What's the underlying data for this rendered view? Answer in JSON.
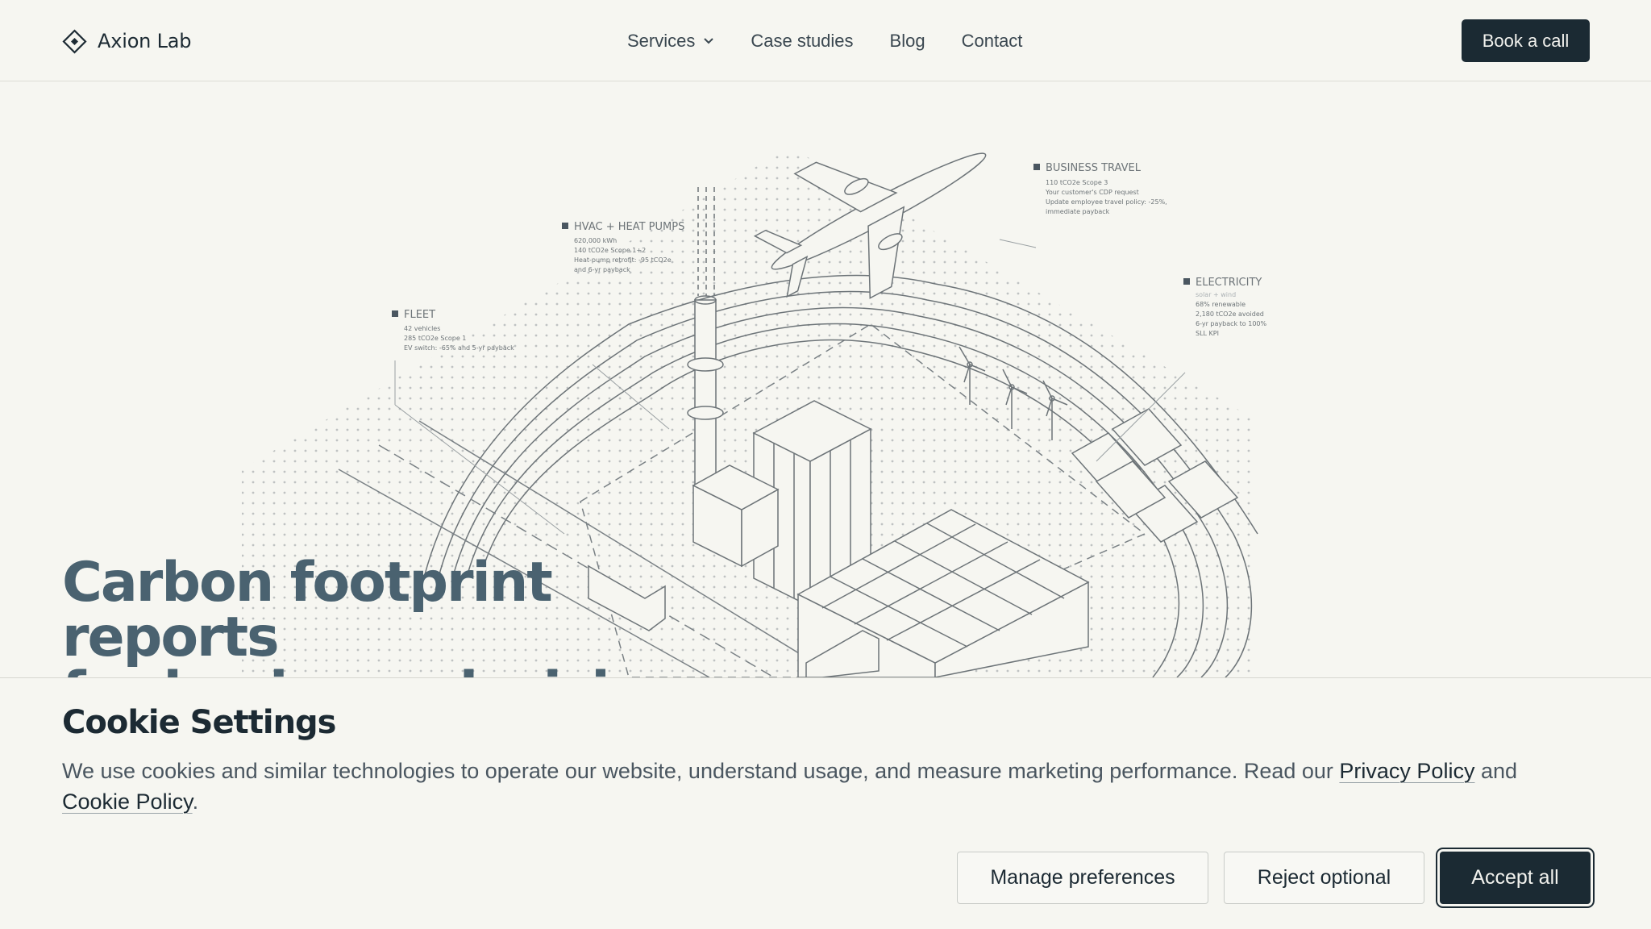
{
  "header": {
    "brand": "Axion Lab",
    "nav": [
      "Services",
      "Case studies",
      "Blog",
      "Contact"
    ],
    "cta": "Book a call"
  },
  "hero": {
    "title_line1": "Carbon footprint reports",
    "title_line2": "for business decisions",
    "callouts": {
      "business_travel": {
        "title": "BUSINESS TRAVEL",
        "lines": [
          "110 tCO2e Scope 3",
          "Your customer's CDP request",
          "Update employee travel policy: -25%,",
          "immediate payback"
        ]
      },
      "hvac": {
        "title": "HVAC + HEAT PUMPS",
        "lines": [
          "620,000 kWh",
          "140 tCO2e Scope 1+2",
          "Heat-pump retrofit: -95 tCO2e",
          "and 6-yr payback"
        ]
      },
      "electricity": {
        "title": "ELECTRICITY",
        "lines": [
          "solar + wind",
          "68% renewable",
          "2,180 tCO2e avoided",
          "6-yr payback to 100%",
          "SLL KPI"
        ]
      },
      "fleet": {
        "title": "FLEET",
        "lines": [
          "42 vehicles",
          "285 tCO2e Scope 1",
          "EV switch: -65% and 5-yr payback"
        ]
      }
    }
  },
  "cookie": {
    "title": "Cookie Settings",
    "text_before": "We use cookies and similar technologies to operate our website, understand usage, and measure marketing performance. Read our ",
    "privacy_link": "Privacy Policy",
    "text_and": " and",
    "cookie_link": "Cookie Policy",
    "text_end": ".",
    "buttons": {
      "manage": "Manage preferences",
      "reject": "Reject optional",
      "accept": "Accept all"
    }
  },
  "colors": {
    "background": "#f6f6f1",
    "ink": "#1b2a33",
    "hero_title": "#4a6270",
    "line_art": "#6d7478"
  }
}
